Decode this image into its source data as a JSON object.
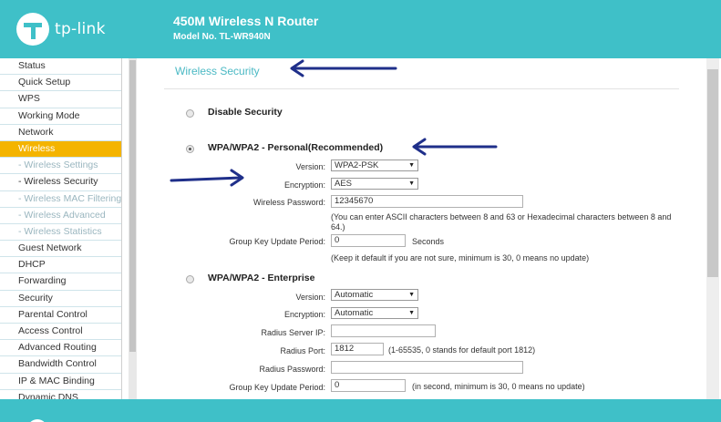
{
  "header": {
    "brand": "tp-link",
    "title": "450M Wireless N Router",
    "model": "Model No. TL-WR940N"
  },
  "sidebar": {
    "items": [
      {
        "label": "Status"
      },
      {
        "label": "Quick Setup"
      },
      {
        "label": "WPS"
      },
      {
        "label": "Working Mode"
      },
      {
        "label": "Network"
      },
      {
        "label": "Wireless"
      },
      {
        "label": "- Wireless Settings"
      },
      {
        "label": "- Wireless Security"
      },
      {
        "label": "- Wireless MAC Filtering"
      },
      {
        "label": "- Wireless Advanced"
      },
      {
        "label": "- Wireless Statistics"
      },
      {
        "label": "Guest Network"
      },
      {
        "label": "DHCP"
      },
      {
        "label": "Forwarding"
      },
      {
        "label": "Security"
      },
      {
        "label": "Parental Control"
      },
      {
        "label": "Access Control"
      },
      {
        "label": "Advanced Routing"
      },
      {
        "label": "Bandwidth Control"
      },
      {
        "label": "IP & MAC Binding"
      },
      {
        "label": "Dynamic DNS"
      }
    ]
  },
  "main": {
    "title": "Wireless Security",
    "disable": {
      "label": "Disable Security"
    },
    "personal": {
      "label": "WPA/WPA2 - Personal(Recommended)",
      "version_label": "Version:",
      "version_value": "WPA2-PSK",
      "encryption_label": "Encryption:",
      "encryption_value": "AES",
      "password_label": "Wireless Password:",
      "password_value": "12345670",
      "password_note": "(You can enter ASCII characters between 8 and 63 or Hexadecimal characters between 8 and 64.)",
      "group_key_label": "Group Key Update Period:",
      "group_key_value": "0",
      "group_key_unit": "Seconds",
      "group_key_note": "(Keep it default if you are not sure, minimum is 30, 0 means no update)"
    },
    "enterprise": {
      "label": "WPA/WPA2 - Enterprise",
      "version_label": "Version:",
      "version_value": "Automatic",
      "encryption_label": "Encryption:",
      "encryption_value": "Automatic",
      "radius_ip_label": "Radius Server IP:",
      "radius_ip_value": "",
      "radius_port_label": "Radius Port:",
      "radius_port_value": "1812",
      "radius_port_note": "(1-65535, 0 stands for default port 1812)",
      "radius_pw_label": "Radius Password:",
      "radius_pw_value": "",
      "group_key_label": "Group Key Update Period:",
      "group_key_value": "0",
      "group_key_note": "(in second, minimum is 30, 0 means no update)"
    }
  },
  "colors": {
    "brand": "#3fc0c8",
    "active_nav": "#f4b400",
    "annotation_arrow": "#1f2f8a"
  }
}
